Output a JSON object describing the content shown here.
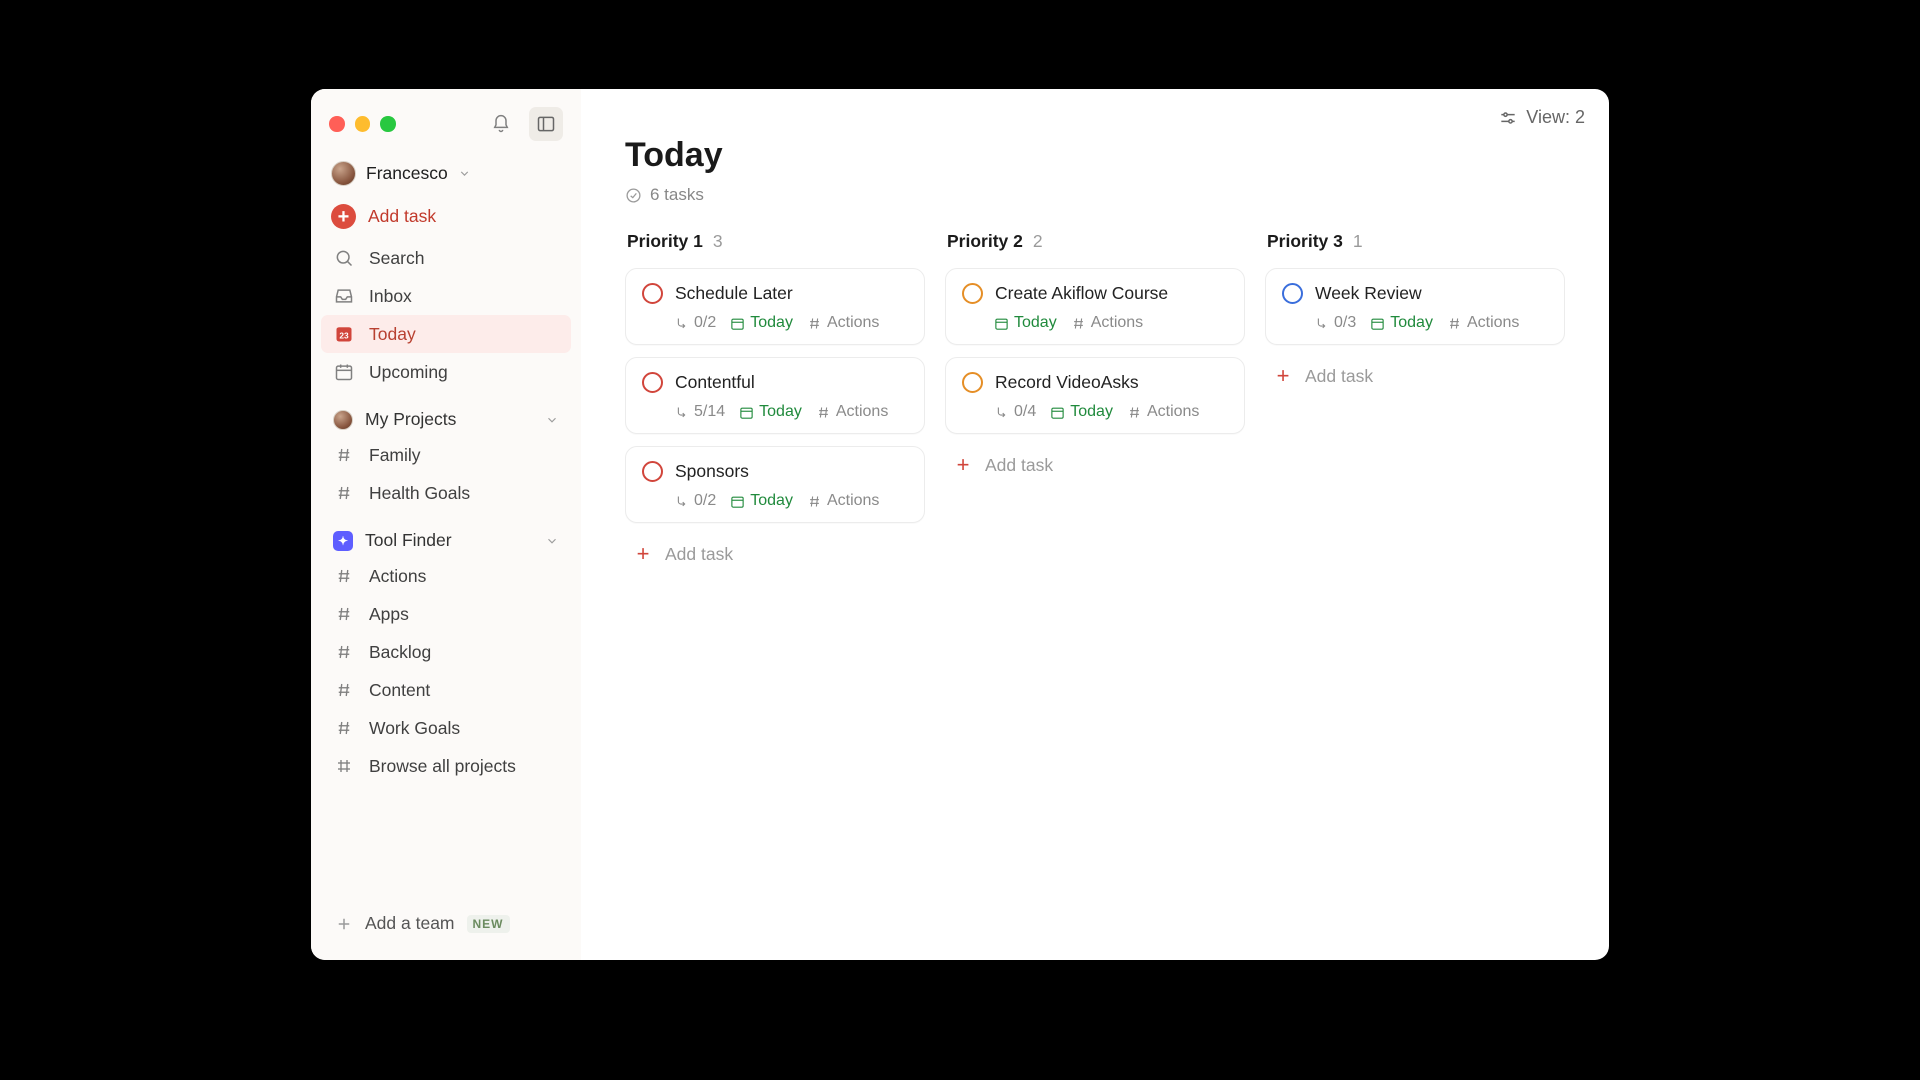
{
  "user": {
    "name": "Francesco"
  },
  "sidebar": {
    "add_task": "Add task",
    "nav": {
      "search": "Search",
      "inbox": "Inbox",
      "today": "Today",
      "upcoming": "Upcoming"
    },
    "sections": [
      {
        "title": "My Projects",
        "icon": "avatar",
        "items": [
          "Family",
          "Health Goals"
        ]
      },
      {
        "title": "Tool Finder",
        "icon": "badge",
        "items": [
          "Actions",
          "Apps",
          "Backlog",
          "Content",
          "Work Goals",
          "Browse all projects"
        ]
      }
    ],
    "add_team": "Add a team",
    "new_badge": "NEW"
  },
  "topbar": {
    "view_label": "View: 2"
  },
  "page": {
    "title": "Today",
    "subtitle": "6 tasks"
  },
  "columns": [
    {
      "title": "Priority 1",
      "count": "3",
      "priority": "p1",
      "tasks": [
        {
          "title": "Schedule Later",
          "sub": "0/2",
          "date": "Today",
          "tag": "Actions"
        },
        {
          "title": "Contentful",
          "sub": "5/14",
          "date": "Today",
          "tag": "Actions"
        },
        {
          "title": "Sponsors",
          "sub": "0/2",
          "date": "Today",
          "tag": "Actions"
        }
      ],
      "add_label": "Add task"
    },
    {
      "title": "Priority 2",
      "count": "2",
      "priority": "p2",
      "tasks": [
        {
          "title": "Create Akiflow Course",
          "sub": "",
          "date": "Today",
          "tag": "Actions"
        },
        {
          "title": "Record VideoAsks",
          "sub": "0/4",
          "date": "Today",
          "tag": "Actions"
        }
      ],
      "add_label": "Add task"
    },
    {
      "title": "Priority 3",
      "count": "1",
      "priority": "p3",
      "tasks": [
        {
          "title": "Week Review",
          "sub": "0/3",
          "date": "Today",
          "tag": "Actions"
        }
      ],
      "add_label": "Add task"
    }
  ]
}
